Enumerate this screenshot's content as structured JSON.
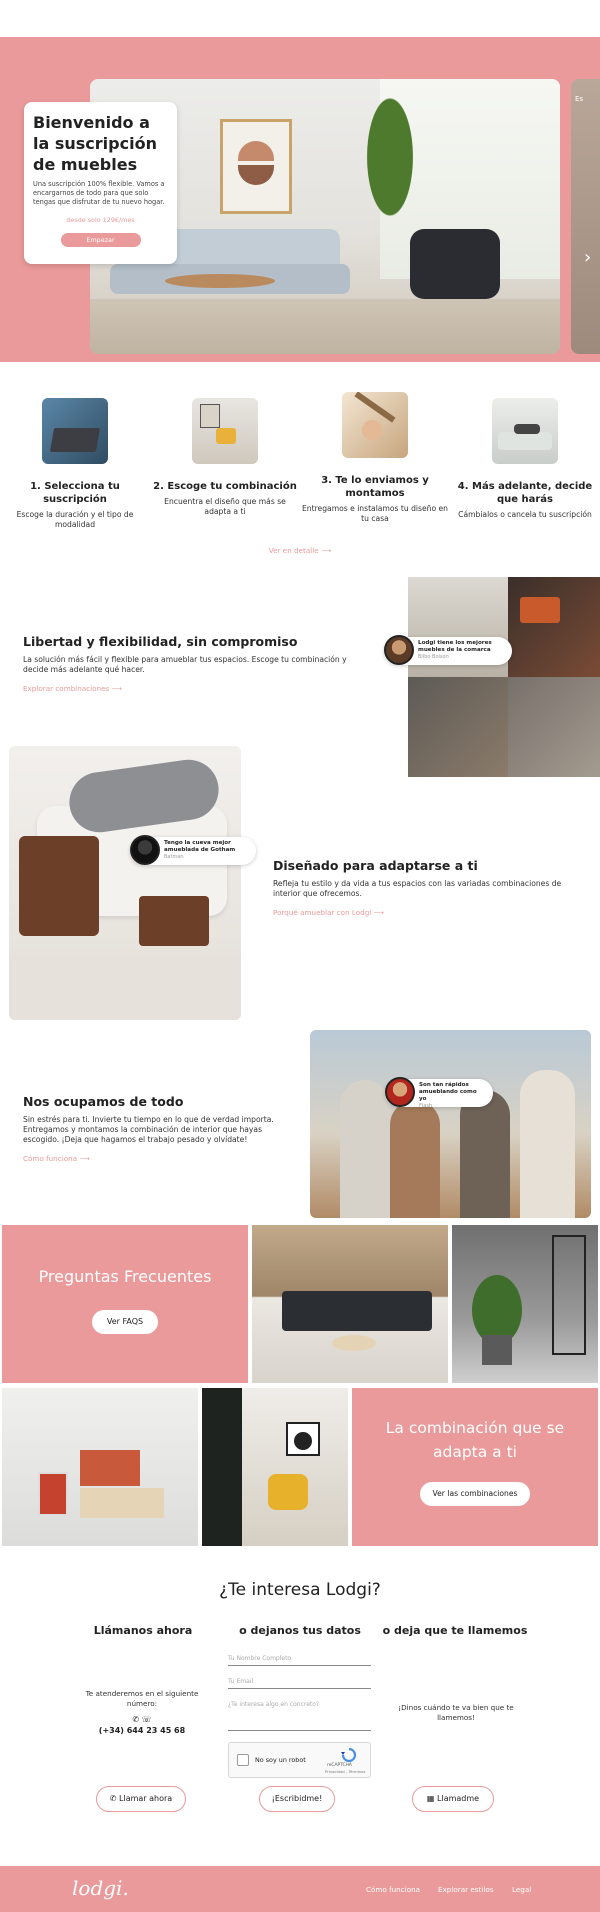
{
  "hero": {
    "title": "Bienvenido a la suscripción de muebles",
    "description": "Una suscripción 100% flexible. Vamos a encargarnos de todo para que solo tengas que disfrutar de tu nuevo hogar.",
    "price": "desde solo 129€/mes",
    "cta": "Empezar",
    "peek_text": "Es",
    "next_icon": "chevron-right-icon"
  },
  "steps": [
    {
      "title": "1. Selecciona tu suscripción",
      "text": "Escoge la duración y el tipo de modalidad"
    },
    {
      "title": "2. Escoge tu combinación",
      "text": "Encuentra el diseño que más se adapta a ti"
    },
    {
      "title": "3. Te lo enviamos y montamos",
      "text": "Entregamos e instalamos tu diseño en tu casa"
    },
    {
      "title": "4. Más adelante, decide que harás",
      "text": "Cámbialos o cancela tu suscripción"
    }
  ],
  "details_link": "Ver en detalle ⟶",
  "features": [
    {
      "title": "Libertad y flexibilidad, sin compromiso",
      "text": "La solución más fácil y flexible para amueblar tus espacios. Escoge tu combinación y decide más adelante qué hacer.",
      "link": "Explorar combinaciones ⟶",
      "badge_title": "Lodgi tiene los mejores muebles de la comarca",
      "badge_sub": "Bilbo Bolsón"
    },
    {
      "title": "Diseñado para adaptarse a ti",
      "text": "Refleja tu estilo y da vida a tus espacios con las variadas combinaciones de interior que ofrecemos.",
      "link": "Porqué amueblar con Lodgi ⟶",
      "badge_title": "Tengo la cueva mejor amueblada de Gotham",
      "badge_sub": "Batman"
    },
    {
      "title": "Nos ocupamos de todo",
      "text": "Sin estrés para ti. Invierte tu tiempo en lo que de verdad importa. Entregamos y montamos la combinación de interior que hayas escogido. ¡Deja que hagamos el trabajo pesado y olvídate!",
      "link": "Cómo funciona ⟶",
      "badge_title": "Son tan rápidos amueblando como yo",
      "badge_sub": "Flash"
    }
  ],
  "faq": {
    "title": "Preguntas Frecuentes",
    "button": "Ver FAQS"
  },
  "combo": {
    "title": "La combinación que se adapta a ti",
    "button": "Ver las combinaciones"
  },
  "contact": {
    "title": "¿Te interesa Lodgi?",
    "col1_title": "Llámanos ahora",
    "col1_text": "Te atenderemos en el siguiente número:",
    "phone": "(+34) 644 23 45 68",
    "col1_icons": "✆ ☏",
    "col2_title": "o dejanos tus datos",
    "name_placeholder": "Tu Nombre Completo",
    "email_placeholder": "Tu Email",
    "message_placeholder": "¿Te interesa algo en concreto?",
    "captcha_label": "No soy un robot",
    "captcha_brand": "reCAPTCHA",
    "captcha_links": "Privacidad - Términos",
    "col3_title": "o deja que te llamemos",
    "col3_text": "¡Dinos cuándo te va bien que te llamemos!",
    "btn_call": "Llamar ahora",
    "btn_write": "¡Escribidme!",
    "btn_callme": "Llamadme"
  },
  "footer": {
    "logo": "lodgi.",
    "links": [
      "Cómo funciona",
      "Explorar estilos",
      "Legal"
    ]
  },
  "colors": {
    "accent": "#ea9a9a",
    "text": "#222222"
  }
}
